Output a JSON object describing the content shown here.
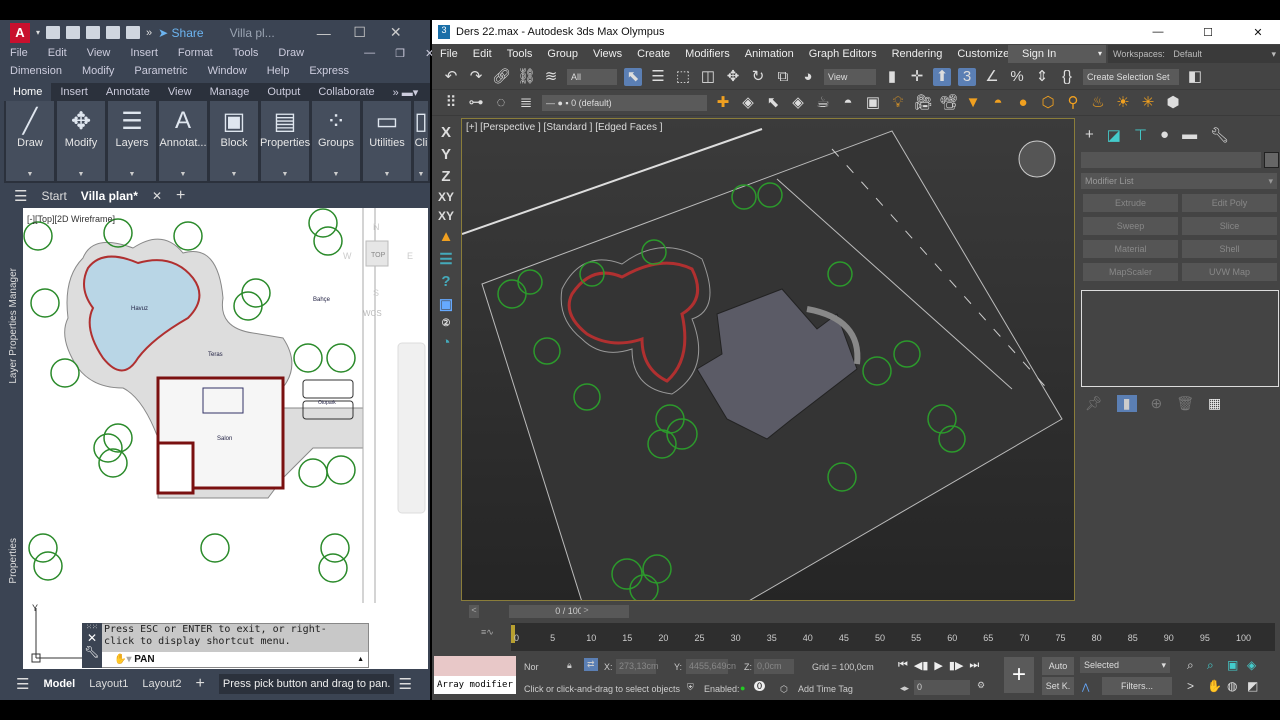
{
  "autocad": {
    "logo": "A",
    "share": "Share",
    "window_title": "Villa pl...",
    "menu_row1": [
      "File",
      "Edit",
      "View",
      "Insert",
      "Format",
      "Tools",
      "Draw"
    ],
    "menu_row2": [
      "Dimension",
      "Modify",
      "Parametric",
      "Window",
      "Help",
      "Express"
    ],
    "ribbon_tabs": [
      "Home",
      "Insert",
      "Annotate",
      "View",
      "Manage",
      "Output",
      "Collaborate"
    ],
    "ribbon_panels": [
      {
        "label": "Draw",
        "icon": "line-icon",
        "glyph": "╱"
      },
      {
        "label": "Modify",
        "icon": "move-icon",
        "glyph": "✥"
      },
      {
        "label": "Layers",
        "icon": "layers-icon",
        "glyph": "☰"
      },
      {
        "label": "Annotat...",
        "icon": "text-icon",
        "glyph": "A"
      },
      {
        "label": "Block",
        "icon": "block-icon",
        "glyph": "▣"
      },
      {
        "label": "Properties",
        "icon": "properties-icon",
        "glyph": "▤"
      },
      {
        "label": "Groups",
        "icon": "groups-icon",
        "glyph": "⁘"
      },
      {
        "label": "Utilities",
        "icon": "ruler-icon",
        "glyph": "▭"
      },
      {
        "label": "Cli",
        "icon": "clipboard-icon",
        "glyph": "▯"
      }
    ],
    "file_tabs": [
      "Start",
      "Villa plan*"
    ],
    "viewport_label": "[-][Top][2D Wireframe]",
    "viewcube": {
      "top": "TOP",
      "n": "N",
      "s": "S",
      "e": "E",
      "w": "W",
      "wcs": "WCS"
    },
    "side_palettes": [
      "Layer Properties Manager",
      "Properties"
    ],
    "plan_labels": [
      "Havuz",
      "Teras",
      "Bahçe",
      "Otopark",
      "Salon"
    ],
    "command": {
      "message": "Press ESC or ENTER to exit, or right-click to display shortcut menu.",
      "line1": "Press ESC or ENTER to exit, or right-",
      "line2": "click to display shortcut menu.",
      "input": "PAN"
    },
    "layout_tabs": [
      "Model",
      "Layout1",
      "Layout2"
    ],
    "status_message": "Press pick button and drag to pan."
  },
  "max": {
    "title": "Ders 22.max - Autodesk 3ds Max Olympus",
    "menu": [
      "File",
      "Edit",
      "Tools",
      "Group",
      "Views",
      "Create",
      "Modifiers",
      "Animation",
      "Graph Editors",
      "Rendering",
      "Customize"
    ],
    "sign_in": "Sign In",
    "workspaces_label": "Workspaces:",
    "workspace": "Default",
    "selection_filter": "All",
    "ref_coord": "View",
    "selection_set": "Create Selection Set",
    "layer": "0 (default)",
    "axis_buttons": [
      "X",
      "Y",
      "Z",
      "XY",
      "XY"
    ],
    "viewport_label": "[+] [Perspective ] [Standard ] [Edged Faces ]",
    "modifier_list": "Modifier List",
    "modifier_buttons": [
      "Extrude",
      "Edit Poly",
      "Sweep",
      "Slice",
      "Material",
      "Shell",
      "MapScaler",
      "UVW Map"
    ],
    "time_slider": "0 / 100",
    "ticks": [
      0,
      5,
      10,
      15,
      20,
      25,
      30,
      35,
      40,
      45,
      50,
      55,
      60,
      65,
      70,
      75,
      80,
      85,
      90,
      95,
      100
    ],
    "script_listener": "Array modifier",
    "nor": "Nor",
    "x": "273,13cm",
    "y": "4455,649cn",
    "z": "0,0cm",
    "x_label": "X:",
    "y_label": "Y:",
    "z_label": "Z:",
    "grid": "Grid = 100,0cm",
    "prompt": "Click or click-and-drag to select objects",
    "enabled": "Enabled:",
    "enabled_count": "0",
    "add_time_tag": "Add Time Tag",
    "frame": "0",
    "auto": "Auto",
    "set_key": "Set K.",
    "key_filter": "Selected",
    "filters": "Filters..."
  }
}
